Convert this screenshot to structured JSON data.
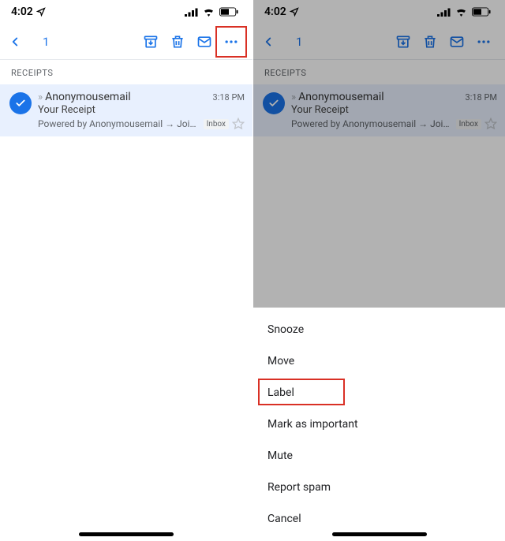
{
  "status": {
    "time": "4:02",
    "loc_icon": "location-icon"
  },
  "toolbar": {
    "count": "1"
  },
  "section": {
    "title": "RECEIPTS"
  },
  "mail": {
    "sender": "Anonymousemail",
    "subject": "Your Receipt",
    "snippet": "Powered by Anonymousemail → Join…",
    "time": "3:18 PM",
    "label": "Inbox"
  },
  "sheet": {
    "items": [
      {
        "label": "Snooze"
      },
      {
        "label": "Move"
      },
      {
        "label": "Label"
      },
      {
        "label": "Mark as important"
      },
      {
        "label": "Mute"
      },
      {
        "label": "Report spam"
      },
      {
        "label": "Cancel"
      }
    ],
    "highlight_index": 2
  },
  "colors": {
    "accent": "#1a73e8",
    "highlight": "#d93025"
  }
}
